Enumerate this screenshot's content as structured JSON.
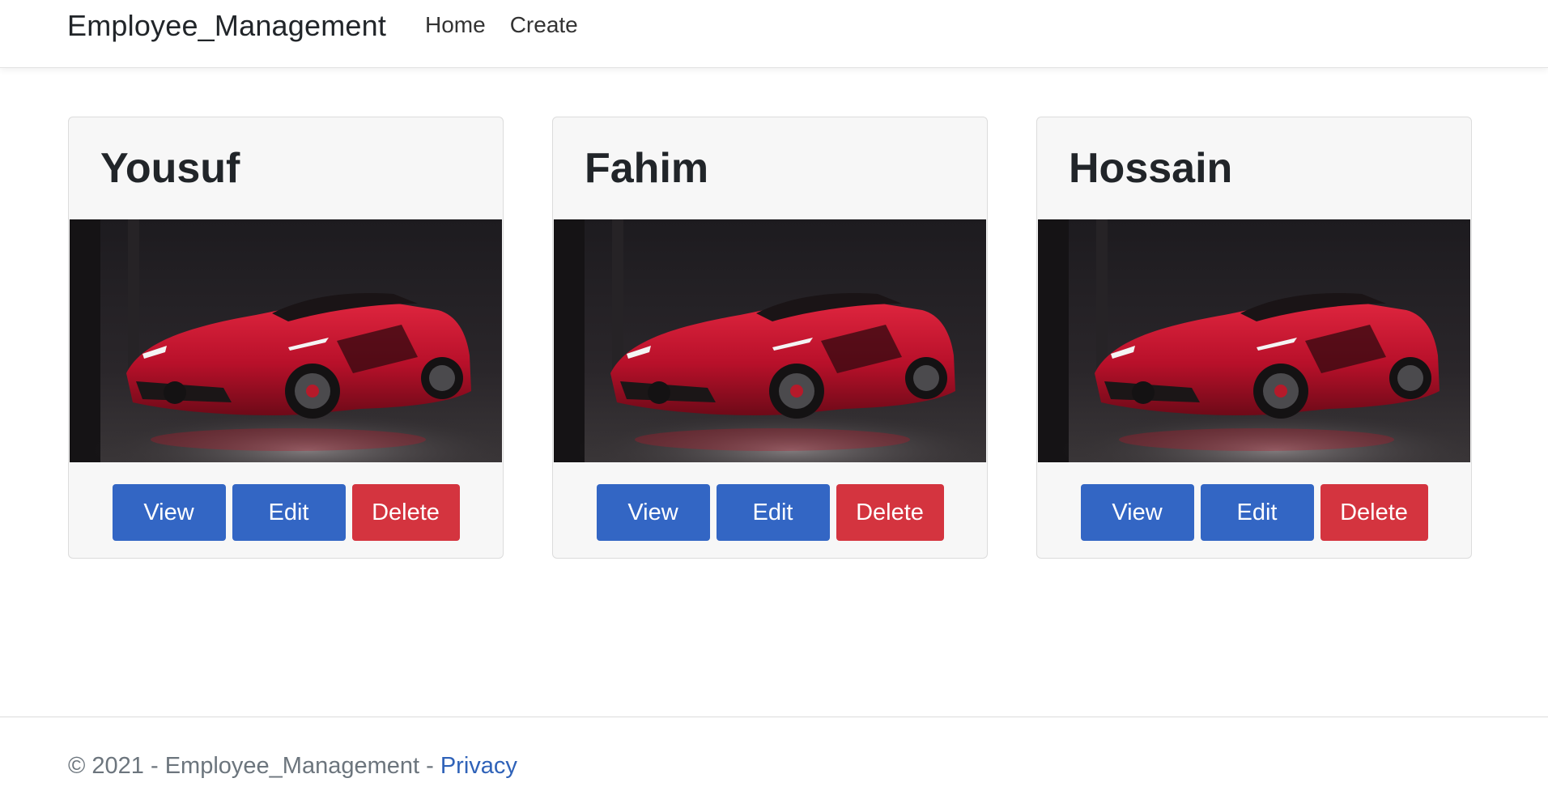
{
  "navbar": {
    "brand": "Employee_Management",
    "links": [
      {
        "label": "Home"
      },
      {
        "label": "Create"
      }
    ]
  },
  "employees": [
    {
      "name": "Yousuf",
      "image": "red-sports-car-photo"
    },
    {
      "name": "Fahim",
      "image": "red-sports-car-photo"
    },
    {
      "name": "Hossain",
      "image": "red-sports-car-photo"
    }
  ],
  "actions": {
    "view": "View",
    "edit": "Edit",
    "delete": "Delete"
  },
  "colors": {
    "primary": "#3366c4",
    "danger": "#d4343f",
    "car": "#c8102e"
  },
  "footer": {
    "copyright": "© 2021 - Employee_Management - ",
    "privacy": "Privacy"
  }
}
